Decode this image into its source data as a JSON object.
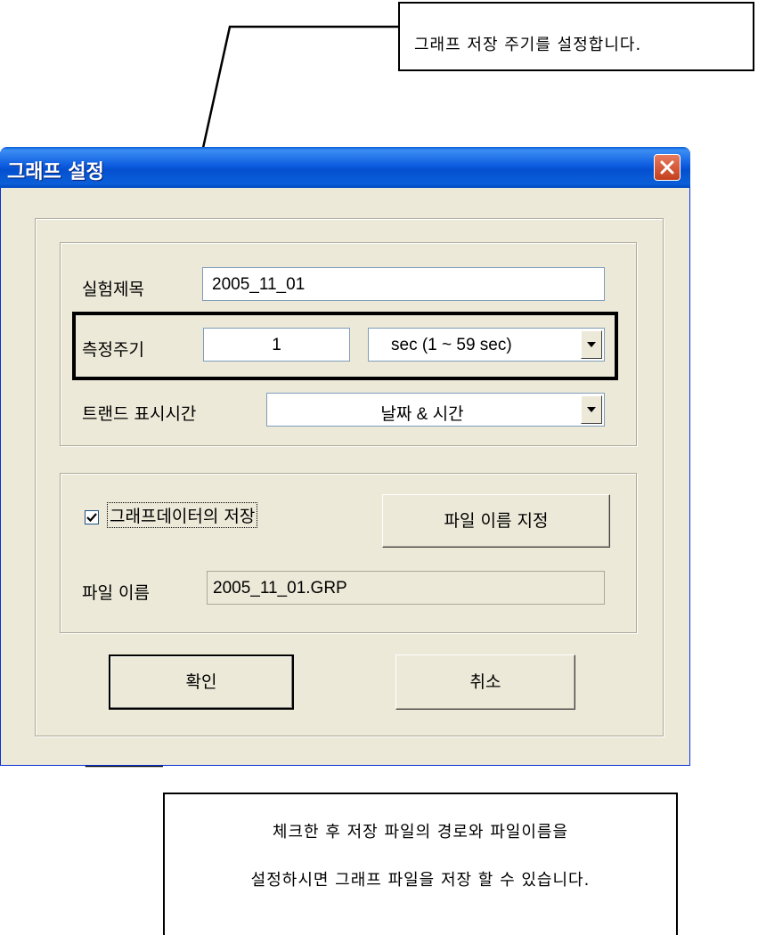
{
  "callouts": {
    "top": "그래프 저장 주기를 설정합니다.",
    "bottom_line1": "체크한 후 저장 파일의 경로와 파일이름을",
    "bottom_line2": "설정하시면 그래프 파일을 저장 할 수 있습니다."
  },
  "dialog": {
    "title": "그래프 설정",
    "close_icon": "close-icon",
    "experiment_title_label": "실험제목",
    "experiment_title_value": "2005_11_01",
    "interval_label": "측정주기",
    "interval_value": "1",
    "interval_unit": "sec (1 ~ 59 sec)",
    "trend_label": "트랜드 표시시간",
    "trend_value": "날짜 & 시간",
    "save_checkbox_label": "그래프데이터의 저장",
    "save_checked": true,
    "filename_button": "파일 이름 지정",
    "filename_label": "파일 이름",
    "filename_value": "2005_11_01.GRP",
    "ok_button": "확인",
    "cancel_button": "취소"
  },
  "colors": {
    "titlebar": "#0a5fd8",
    "dialog_bg": "#ece9d8",
    "close_button": "#c33f1d"
  }
}
